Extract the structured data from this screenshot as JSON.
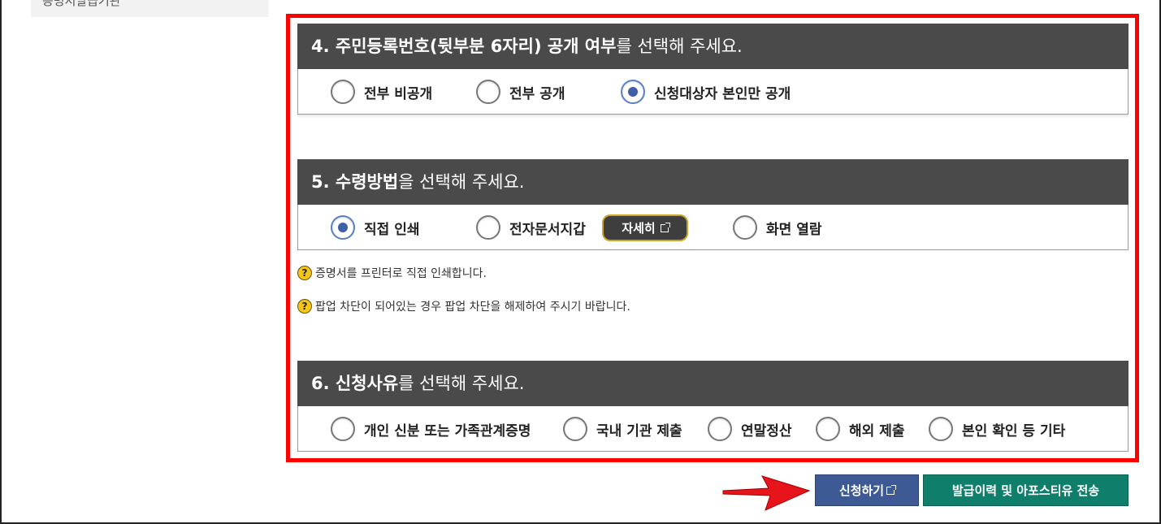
{
  "left_menu": {
    "partial_item": "증명서발급기관"
  },
  "section4": {
    "title_bold": "4. 주민등록번호(뒷부분 6자리) 공개 여부",
    "title_rest": "를 선택해 주세요.",
    "options": [
      {
        "label": "전부 비공개",
        "checked": false
      },
      {
        "label": "전부 공개",
        "checked": false
      },
      {
        "label": "신청대상자 본인만 공개",
        "checked": true
      }
    ]
  },
  "section5": {
    "title_bold": "5. 수령방법",
    "title_rest": "을 선택해 주세요.",
    "options": [
      {
        "label": "직접 인쇄",
        "checked": true
      },
      {
        "label": "전자문서지갑",
        "checked": false
      },
      {
        "label": "화면 열람",
        "checked": false
      }
    ],
    "detail_button": "자세히",
    "notes": [
      "증명서를 프린터로 직접 인쇄합니다.",
      "팝업 차단이 되어있는 경우 팝업 차단을 해제하여 주시기 바랍니다."
    ]
  },
  "section6": {
    "title_bold": "6. 신청사유",
    "title_rest": "를 선택해 주세요.",
    "options": [
      {
        "label": "개인 신분 또는 가족관계증명",
        "checked": false
      },
      {
        "label": "국내 기관 제출",
        "checked": false
      },
      {
        "label": "연말정산",
        "checked": false
      },
      {
        "label": "해외 제출",
        "checked": false
      },
      {
        "label": "본인 확인 등 기타",
        "checked": false
      }
    ]
  },
  "actions": {
    "apply_label": "신청하기",
    "send_label": "발급이력 및 아포스티유 전송"
  },
  "colors": {
    "highlight": "#ff0000",
    "header_bg": "#4a4a4a",
    "apply_bg": "#3d5a94",
    "send_bg": "#0f7f6b",
    "arrow": "#e8141b"
  },
  "icons": {
    "note_icon": "question-icon",
    "external": "external-link-icon",
    "pointer": "arrow-right-icon"
  }
}
